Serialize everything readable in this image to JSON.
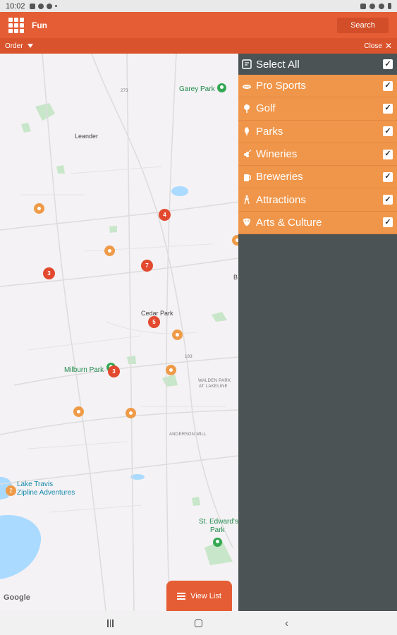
{
  "status_bar": {
    "time": "10:02"
  },
  "app_bar": {
    "title": "Fun",
    "search_label": "Search"
  },
  "sub_bar": {
    "order_label": "Order",
    "close_label": "Close"
  },
  "map": {
    "labels": {
      "garey_park": "Garey Park",
      "leander": "Leander",
      "cedar_park": "Cedar Park",
      "milburn_park": "Milburn Park",
      "lake_travis_line1": "Lake Travis",
      "lake_travis_line2": "Zipline Adventures",
      "st_edwards_line1": "St. Edward's",
      "st_edwards_line2": "Park",
      "walden_line1": "WALDEN PARK",
      "walden_line2": "AT LAKELINE",
      "anderson_mill": "ANDERSON MILL",
      "road_273": "273",
      "road_183": "183",
      "edge_b": "B"
    },
    "clusters": [
      "4",
      "7",
      "3",
      "5",
      "3"
    ],
    "orange_cluster": "2",
    "google_label": "Google",
    "view_list_label": "View List"
  },
  "filter_panel": {
    "select_all": {
      "label": "Select All",
      "checked": true
    },
    "items": [
      {
        "label": "Pro Sports",
        "icon": "sports-icon",
        "checked": true
      },
      {
        "label": "Golf",
        "icon": "golf-icon",
        "checked": true
      },
      {
        "label": "Parks",
        "icon": "parks-icon",
        "checked": true
      },
      {
        "label": "Wineries",
        "icon": "wineries-icon",
        "checked": true
      },
      {
        "label": "Breweries",
        "icon": "breweries-icon",
        "checked": true
      },
      {
        "label": "Attractions",
        "icon": "attractions-icon",
        "checked": true
      },
      {
        "label": "Arts & Culture",
        "icon": "arts-culture-icon",
        "checked": true
      }
    ],
    "check_mark": "✓",
    "accent_color": "#f0964a",
    "panel_color": "#4b5355"
  },
  "colors": {
    "app_bar": "#e55d35",
    "cluster": "#e2492e",
    "park_green": "#34a853"
  }
}
